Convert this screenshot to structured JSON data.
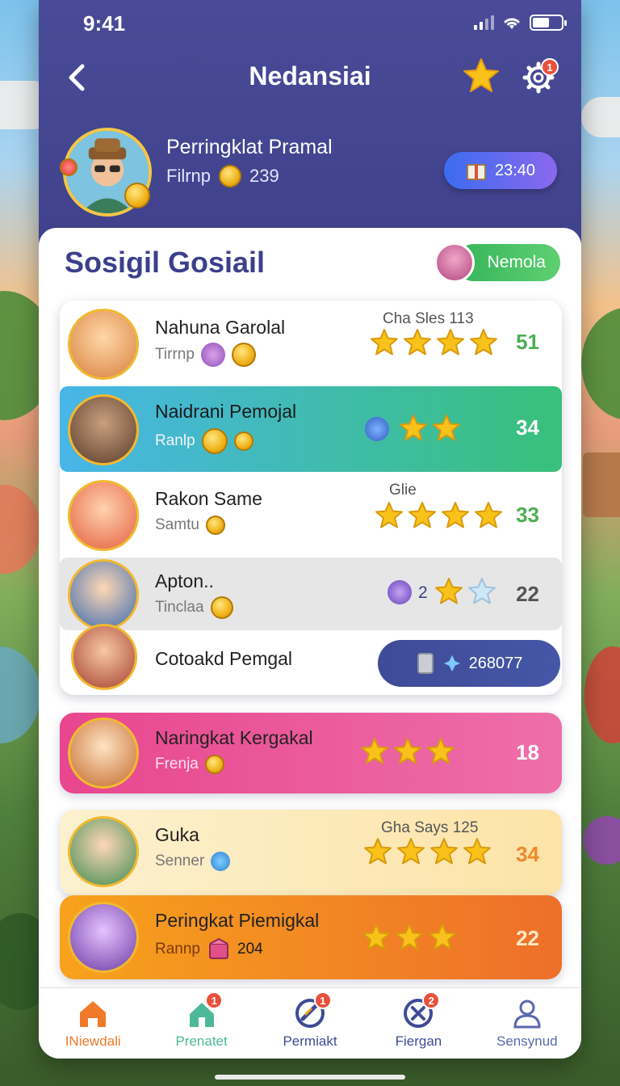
{
  "status_bar": {
    "time": "9:41"
  },
  "header": {
    "title": "Nedansiai",
    "settings_badge": "1",
    "profile": {
      "name": "Perringklat Pramal",
      "sub_label": "Filrnp",
      "coins": "239",
      "timer": "23:40"
    }
  },
  "section": {
    "title": "Sosigil Gosiail",
    "friend_button": "Nemola"
  },
  "leaderboard": [
    {
      "name": "Nahuna Garolal",
      "sub": "Tirrnp",
      "extra": "Cha Sles 113",
      "stars": 4,
      "score": "51",
      "score_color": "#4caf50"
    },
    {
      "name": "Naidrani Pemojal",
      "sub": "Ranlp",
      "extra": "",
      "stars": 2,
      "score": "34",
      "score_color": "#ffffff"
    },
    {
      "name": "Rakon Same",
      "sub": "Samtu",
      "extra": "Glie",
      "stars": 4,
      "score": "33",
      "score_color": "#4caf50"
    },
    {
      "name": "Apton..",
      "sub": "Tinclaa",
      "extra": "2",
      "stars": 2,
      "score": "22",
      "score_color": "#555555"
    },
    {
      "name": "Cotoakd Pemgal",
      "gems": "268077"
    }
  ],
  "cards": [
    {
      "name": "Naringkat Kergakal",
      "sub": "Frenja",
      "stars": 3,
      "score": "18",
      "score_color": "#ffffff"
    },
    {
      "name": "Guka",
      "sub": "Senner",
      "extra": "Gha Says 125",
      "stars": 4,
      "score": "34",
      "score_color": "#f0882a"
    },
    {
      "name": "Peringkat Piemigkal",
      "sub": "Rannp",
      "count": "204",
      "stars": 3,
      "score": "22",
      "score_color": "#fde9c4"
    }
  ],
  "bottom_nav": [
    {
      "label": "INiewdali",
      "color": "#f07a2a",
      "badge": ""
    },
    {
      "label": "Prenatet",
      "color": "#4fb89a",
      "badge": "1"
    },
    {
      "label": "Permiakt",
      "color": "#3e4b97",
      "badge": "1"
    },
    {
      "label": "Fiergan",
      "color": "#3e4b97",
      "badge": "2"
    },
    {
      "label": "Sensynud",
      "color": "#5a67b0",
      "badge": ""
    }
  ],
  "colors": {
    "header_bg": "#4a4b98",
    "accent_green": "#4caf50",
    "accent_orange": "#f07a2a",
    "accent_pink": "#e8468e",
    "star": "#f9c21a"
  },
  "icons": [
    "back-chevron-icon",
    "star-icon",
    "gear-icon",
    "coin-icon",
    "gift-icon",
    "gem-icon",
    "home-icon",
    "house-icon",
    "badge-icon",
    "cross-icon",
    "user-icon"
  ]
}
